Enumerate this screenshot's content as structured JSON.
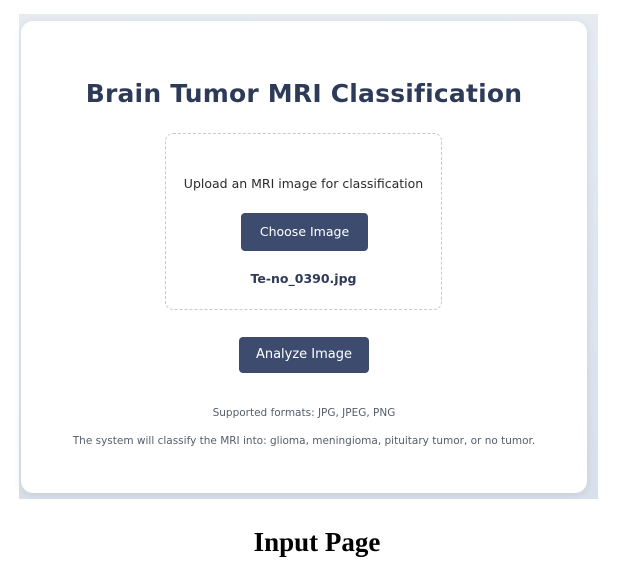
{
  "app": {
    "title": "Brain Tumor MRI Classification"
  },
  "upload": {
    "prompt": "Upload an MRI image for classification",
    "choose_label": "Choose Image",
    "selected_file": "Te-no_0390.jpg"
  },
  "actions": {
    "analyze_label": "Analyze Image"
  },
  "info": {
    "formats": "Supported formats: JPG, JPEG, PNG",
    "classes": "The system will classify the MRI into: glioma, meningioma, pituitary tumor, or no tumor."
  },
  "caption": "Input Page",
  "colors": {
    "accent": "#3d4c6e",
    "title": "#2d3b59",
    "background": "#dfe5ee"
  }
}
